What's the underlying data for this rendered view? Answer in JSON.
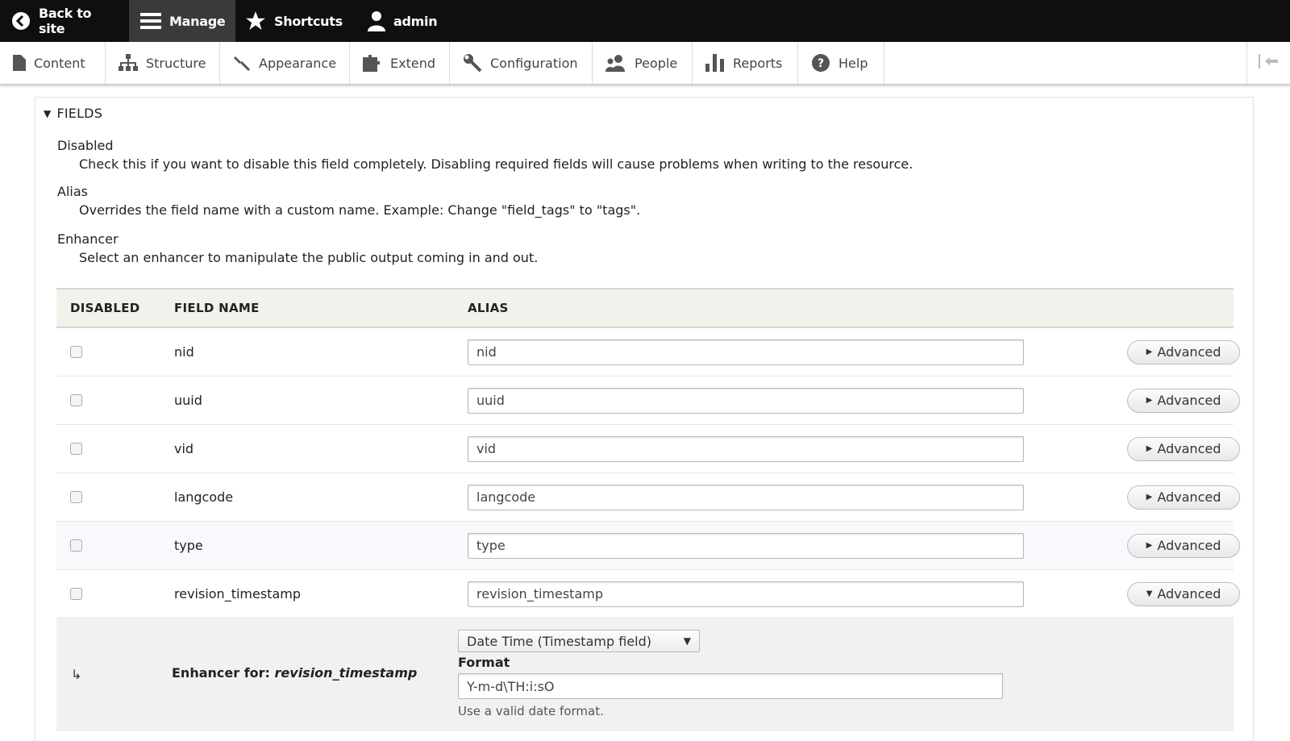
{
  "toolbar": {
    "back": "Back to site",
    "manage": "Manage",
    "shortcuts": "Shortcuts",
    "user": "admin"
  },
  "tray": {
    "items": [
      "Content",
      "Structure",
      "Appearance",
      "Extend",
      "Configuration",
      "People",
      "Reports",
      "Help"
    ]
  },
  "fieldset": {
    "legend": "FIELDS",
    "descriptions": [
      {
        "term": "Disabled",
        "def": "Check this if you want to disable this field completely. Disabling required fields will cause problems when writing to the resource."
      },
      {
        "term": "Alias",
        "def": "Overrides the field name with a custom name. Example: Change \"field_tags\" to \"tags\"."
      },
      {
        "term": "Enhancer",
        "def": "Select an enhancer to manipulate the public output coming in and out."
      }
    ]
  },
  "table": {
    "headers": {
      "disabled": "DISABLED",
      "field_name": "FIELD NAME",
      "alias": "ALIAS"
    },
    "advanced_label": "Advanced",
    "rows": [
      {
        "name": "nid",
        "alias": "nid"
      },
      {
        "name": "uuid",
        "alias": "uuid"
      },
      {
        "name": "vid",
        "alias": "vid"
      },
      {
        "name": "langcode",
        "alias": "langcode"
      },
      {
        "name": "type",
        "alias": "type"
      },
      {
        "name": "revision_timestamp",
        "alias": "revision_timestamp"
      }
    ]
  },
  "enhancer": {
    "arrow": "↳",
    "label_prefix": "Enhancer for: ",
    "label_field": "revision_timestamp",
    "select_value": "Date Time (Timestamp field)",
    "format_label": "Format",
    "format_value": "Y-m-d\\TH:i:sO",
    "help": "Use a valid date format."
  }
}
